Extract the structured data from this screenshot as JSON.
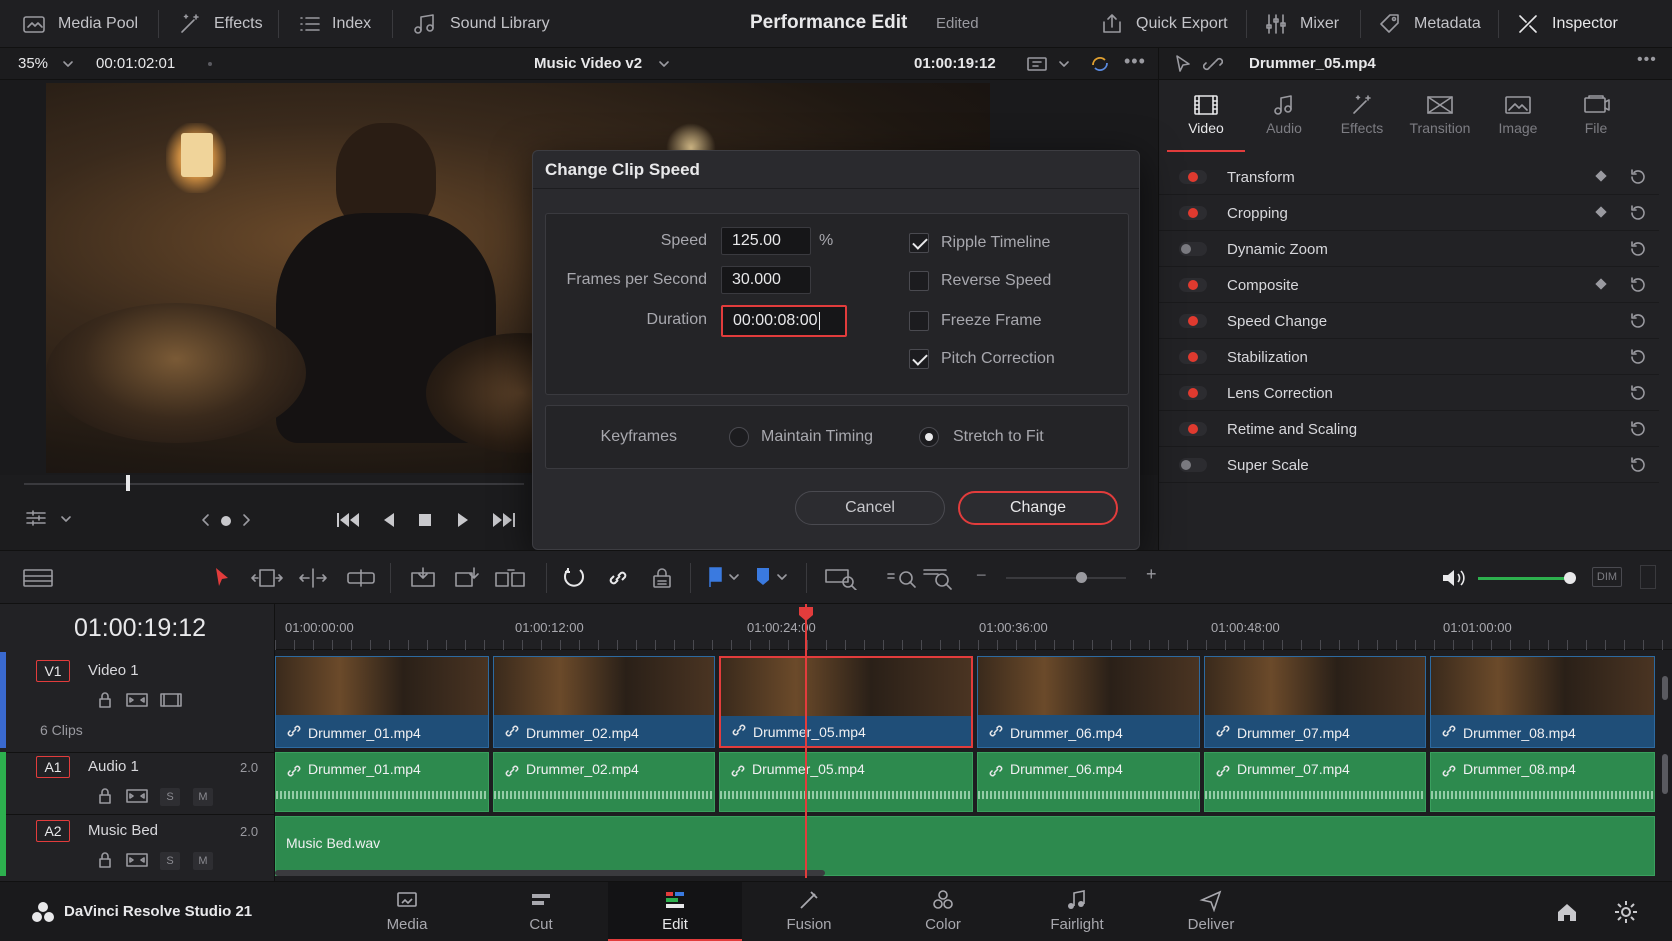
{
  "topbar": {
    "media_pool": "Media Pool",
    "effects": "Effects",
    "index": "Index",
    "sound_library": "Sound Library",
    "project_title": "Performance Edit",
    "status": "Edited",
    "quick_export": "Quick Export",
    "mixer": "Mixer",
    "metadata": "Metadata",
    "inspector": "Inspector"
  },
  "viewer": {
    "zoom": "35%",
    "source_timecode": "00:01:02:01",
    "timeline_name": "Music Video v2",
    "record_timecode": "01:00:19:12"
  },
  "inspector": {
    "clip_name": "Drummer_05.mp4",
    "tabs": [
      {
        "label": "Video",
        "icon": "film-icon"
      },
      {
        "label": "Audio",
        "icon": "music-note-icon"
      },
      {
        "label": "Effects",
        "icon": "magic-wand-icon"
      },
      {
        "label": "Transition",
        "icon": "transition-icon"
      },
      {
        "label": "Image",
        "icon": "image-icon"
      },
      {
        "label": "File",
        "icon": "file-icon"
      }
    ],
    "rows": [
      {
        "label": "Transform",
        "enabled": true,
        "keyframe": true
      },
      {
        "label": "Cropping",
        "enabled": true,
        "keyframe": true
      },
      {
        "label": "Dynamic Zoom",
        "enabled": false,
        "keyframe": false
      },
      {
        "label": "Composite",
        "enabled": true,
        "keyframe": true
      },
      {
        "label": "Speed Change",
        "enabled": true,
        "keyframe": false
      },
      {
        "label": "Stabilization",
        "enabled": true,
        "keyframe": false
      },
      {
        "label": "Lens Correction",
        "enabled": true,
        "keyframe": false
      },
      {
        "label": "Retime and Scaling",
        "enabled": true,
        "keyframe": false
      },
      {
        "label": "Super Scale",
        "enabled": false,
        "keyframe": false
      }
    ]
  },
  "dialog": {
    "title": "Change Clip Speed",
    "speed_label": "Speed",
    "speed_value": "125.00",
    "speed_unit": "%",
    "fps_label": "Frames per Second",
    "fps_value": "30.000",
    "duration_label": "Duration",
    "duration_value": "00:00:08:00",
    "ripple_timeline": "Ripple Timeline",
    "reverse_speed": "Reverse Speed",
    "freeze_frame": "Freeze Frame",
    "pitch_correction": "Pitch Correction",
    "keyframes_label": "Keyframes",
    "maintain_timing": "Maintain Timing",
    "stretch_to_fit": "Stretch to Fit",
    "cancel": "Cancel",
    "change": "Change"
  },
  "timeline": {
    "timecode": "01:00:19:12",
    "ruler": [
      "01:00:00:00",
      "01:00:12:00",
      "01:00:24:00",
      "01:00:36:00",
      "01:00:48:00",
      "01:01:00:00"
    ],
    "v1": {
      "tag": "V1",
      "name": "Video 1",
      "clip_count": "6 Clips"
    },
    "a1": {
      "tag": "A1",
      "name": "Audio 1",
      "level": "2.0"
    },
    "a2": {
      "tag": "A2",
      "name": "Music Bed",
      "level": "2.0"
    },
    "solo": "S",
    "mute": "M",
    "clips": [
      "Drummer_01.mp4",
      "Drummer_02.mp4",
      "Drummer_05.mp4",
      "Drummer_06.mp4",
      "Drummer_07.mp4",
      "Drummer_08.mp4"
    ],
    "music_bed": "Music Bed.wav",
    "dim": "DIM"
  },
  "app": {
    "name": "DaVinci Resolve Studio 21"
  },
  "pages": [
    {
      "label": "Media",
      "icon": "media-icon"
    },
    {
      "label": "Cut",
      "icon": "cut-icon"
    },
    {
      "label": "Edit",
      "icon": "edit-icon"
    },
    {
      "label": "Fusion",
      "icon": "fusion-icon"
    },
    {
      "label": "Color",
      "icon": "color-icon"
    },
    {
      "label": "Fairlight",
      "icon": "fairlight-icon"
    },
    {
      "label": "Deliver",
      "icon": "deliver-icon"
    }
  ],
  "colors": {
    "accent": "#e23c3c",
    "video_clip": "#1f4e78",
    "audio_clip": "#2d8a4e"
  }
}
